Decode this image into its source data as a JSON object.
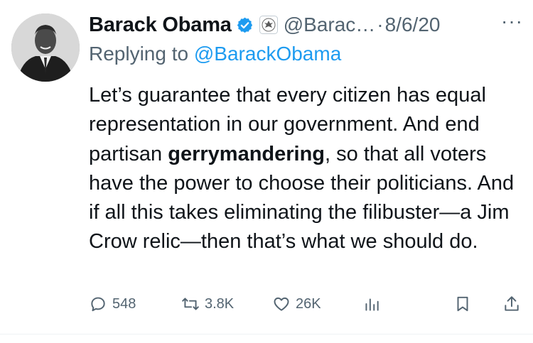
{
  "author": {
    "name": "Barack Obama",
    "handle": "@Barac…",
    "date": "8/6/20",
    "separator": "·",
    "verified_color": "#1d9bf0"
  },
  "reply": {
    "prefix": "Replying to ",
    "mention": "@BarackObama"
  },
  "tweet": {
    "text_before": "Let’s guarantee that every citizen has equal representation in our government. And end partisan ",
    "bold_word": "gerrymandering",
    "text_after": ", so that all voters have the power to choose their politicians. And if all this takes eliminating the filibuster—a Jim Crow relic—then that’s what we should do."
  },
  "actions": {
    "replies": "548",
    "retweets": "3.8K",
    "likes": "26K"
  },
  "icons": {
    "more": "more-icon",
    "reply": "reply-icon",
    "retweet": "retweet-icon",
    "like": "heart-icon",
    "views": "views-icon",
    "bookmark": "bookmark-icon",
    "share": "share-icon"
  },
  "colors": {
    "text": "#0f1419",
    "secondary": "#536471",
    "link": "#1d9bf0"
  }
}
